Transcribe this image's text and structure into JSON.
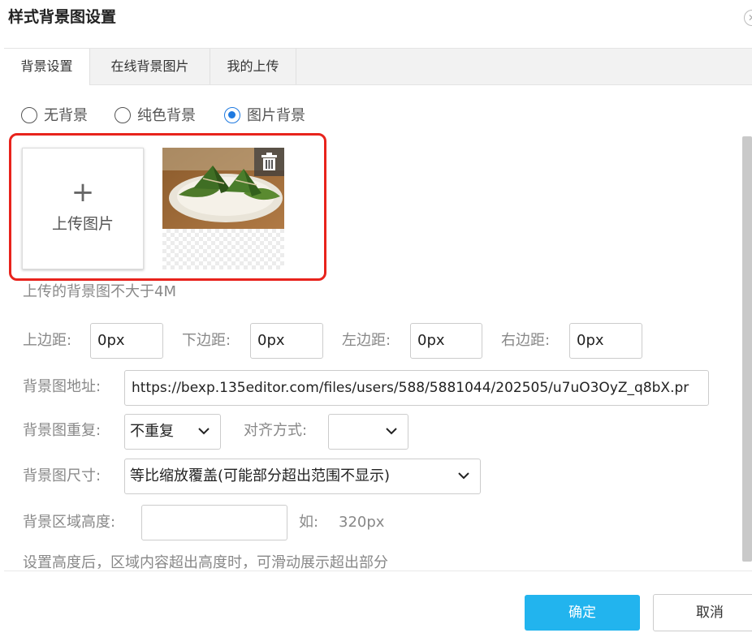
{
  "dialog": {
    "title": "样式背景图设置"
  },
  "tabs": [
    {
      "label": "背景设置",
      "active": true
    },
    {
      "label": "在线背景图片",
      "active": false
    },
    {
      "label": "我的上传",
      "active": false
    }
  ],
  "background_type": {
    "options": [
      "无背景",
      "纯色背景",
      "图片背景"
    ],
    "selected": "图片背景"
  },
  "upload": {
    "plus": "+",
    "label": "上传图片",
    "hint": "上传的背景图不大于4M"
  },
  "margins": {
    "top_label": "上边距:",
    "top_value": "0px",
    "bottom_label": "下边距:",
    "bottom_value": "0px",
    "left_label": "左边距:",
    "left_value": "0px",
    "right_label": "右边距:",
    "right_value": "0px"
  },
  "image_url": {
    "label": "背景图地址:",
    "value": "https://bexp.135editor.com/files/users/588/5881044/202505/u7uO3OyZ_q8bX.pr"
  },
  "repeat": {
    "label": "背景图重复:",
    "value": "不重复"
  },
  "align": {
    "label": "对齐方式:",
    "value": ""
  },
  "size": {
    "label": "背景图尺寸:",
    "value": "等比缩放覆盖(可能部分超出范围不显示)"
  },
  "height": {
    "label": "背景区域高度:",
    "value": "",
    "example_label": "如:",
    "example_value": "320px"
  },
  "height_hint": "设置高度后，区域内容超出高度时，可滑动展示超出部分",
  "buttons": {
    "confirm": "确定",
    "cancel": "取消"
  },
  "colors": {
    "accent": "#1f7ae0",
    "confirm": "#22b4ee",
    "highlight": "#e8231c"
  }
}
